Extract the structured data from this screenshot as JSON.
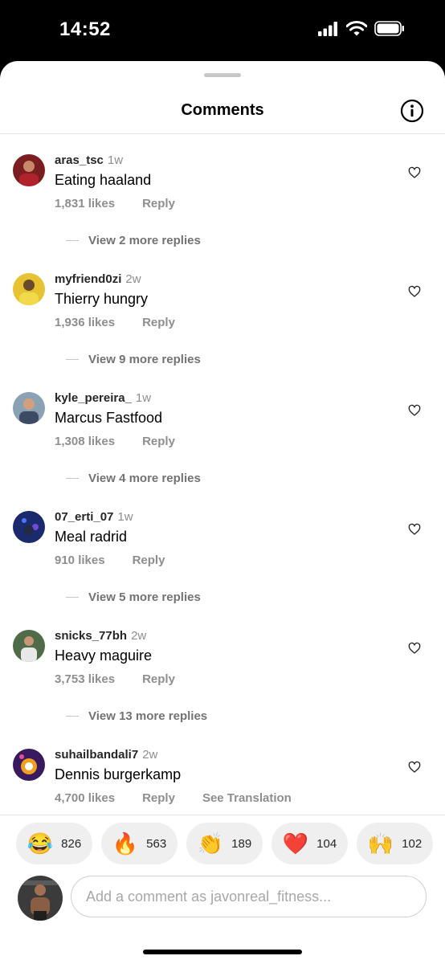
{
  "status": {
    "time": "14:52"
  },
  "header": {
    "title": "Comments"
  },
  "comments": [
    {
      "username": "aras_tsc",
      "age": "1w",
      "text": "Eating haaland",
      "likes": "1,831 likes",
      "reply": "Reply",
      "more_replies": "View 2 more replies",
      "avatar_color": "#7a1e22"
    },
    {
      "username": "myfriend0zi",
      "age": "2w",
      "text": "Thierry hungry",
      "likes": "1,936 likes",
      "reply": "Reply",
      "more_replies": "View 9 more replies",
      "avatar_color": "#e7c233"
    },
    {
      "username": "kyle_pereira_",
      "age": "1w",
      "text": "Marcus Fastfood",
      "likes": "1,308 likes",
      "reply": "Reply",
      "more_replies": "View 4 more replies",
      "avatar_color": "#8aa2b4"
    },
    {
      "username": "07_erti_07",
      "age": "1w",
      "text": "Meal radrid",
      "likes": "910 likes",
      "reply": "Reply",
      "more_replies": "View 5 more replies",
      "avatar_color": "#1a2a6c"
    },
    {
      "username": "snicks_77bh",
      "age": "2w",
      "text": "Heavy maguire",
      "likes": "3,753 likes",
      "reply": "Reply",
      "more_replies": "View 13 more replies",
      "avatar_color": "#4f6b48"
    },
    {
      "username": "suhailbandali7",
      "age": "2w",
      "text": "Dennis burgerkamp",
      "likes": "4,700 likes",
      "reply": "Reply",
      "translation": "See Translation",
      "avatar_color": "#3a1a5e"
    }
  ],
  "reactions": [
    {
      "emoji": "😂",
      "count": "826"
    },
    {
      "emoji": "🔥",
      "count": "563"
    },
    {
      "emoji": "👏",
      "count": "189"
    },
    {
      "emoji": "❤️",
      "count": "104"
    },
    {
      "emoji": "🙌",
      "count": "102"
    }
  ],
  "composer": {
    "placeholder": "Add a comment as javonreal_fitness..."
  }
}
